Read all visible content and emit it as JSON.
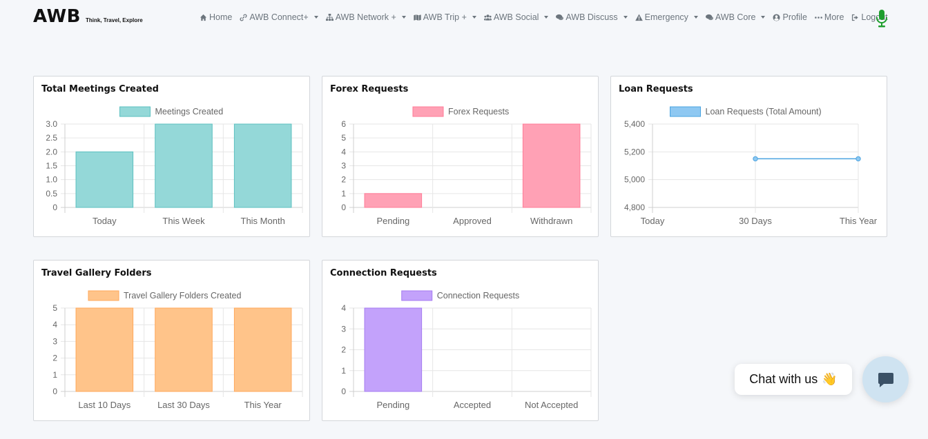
{
  "brand": {
    "name": "AWB",
    "tagline": "Think, Travel, Explore"
  },
  "nav": [
    {
      "label": "Home",
      "icon": "home-icon",
      "caret": false
    },
    {
      "label": "AWB Connect+",
      "icon": "link-icon",
      "caret": true
    },
    {
      "label": "AWB Network +",
      "icon": "sitemap-icon",
      "caret": true
    },
    {
      "label": "AWB Trip +",
      "icon": "map-icon",
      "caret": true
    },
    {
      "label": "AWB Social",
      "icon": "users-icon",
      "caret": true
    },
    {
      "label": "AWB Discuss",
      "icon": "comments-icon",
      "caret": true
    },
    {
      "label": "Emergency",
      "icon": "warning-icon",
      "caret": true
    },
    {
      "label": "AWB Core",
      "icon": "comments-icon",
      "caret": true
    },
    {
      "label": "Profile",
      "icon": "user-circle-icon",
      "caret": false
    },
    {
      "label": "More",
      "icon": "ellipsis-icon",
      "caret": false
    },
    {
      "label": "Logout",
      "icon": "logout-icon",
      "caret": false
    }
  ],
  "mic": {
    "icon": "microphone-icon",
    "color": "#1e9e2e"
  },
  "cards": [
    {
      "title": "Total Meetings Created",
      "chart_data": {
        "type": "bar",
        "categories": [
          "Today",
          "This Week",
          "This Month"
        ],
        "series": [
          {
            "name": "Meetings Created",
            "values": [
              2,
              3,
              3
            ]
          }
        ],
        "ylim": [
          0,
          3
        ],
        "yticks": [
          "3.0",
          "2.5",
          "2.0",
          "1.5",
          "1.0",
          "0.5",
          "0"
        ],
        "fill": "#94d8d8",
        "stroke": "#5bc0c0"
      }
    },
    {
      "title": "Forex Requests",
      "chart_data": {
        "type": "bar",
        "categories": [
          "Pending",
          "Approved",
          "Withdrawn"
        ],
        "series": [
          {
            "name": "Forex Requests",
            "values": [
              1,
              0,
              6
            ]
          }
        ],
        "ylim": [
          0,
          6
        ],
        "yticks": [
          "6",
          "5",
          "4",
          "3",
          "2",
          "1",
          "0"
        ],
        "fill": "#ffa1b5",
        "stroke": "#ff7b97"
      }
    },
    {
      "title": "Loan Requests",
      "chart_data": {
        "type": "line",
        "categories": [
          "Today",
          "30 Days",
          "This Year"
        ],
        "series": [
          {
            "name": "Loan Requests (Total Amount)",
            "values": [
              null,
              5150,
              5150
            ]
          }
        ],
        "ylim": [
          4800,
          5400
        ],
        "yticks": [
          "5,400",
          "5,200",
          "5,000",
          "4,800"
        ],
        "fill": "#8ec8f2",
        "stroke": "#4aa3e0"
      }
    },
    {
      "title": "Travel Gallery Folders",
      "chart_data": {
        "type": "bar",
        "categories": [
          "Last 10 Days",
          "Last 30 Days",
          "This Year"
        ],
        "series": [
          {
            "name": "Travel Gallery Folders Created",
            "values": [
              5,
              5,
              5
            ]
          }
        ],
        "ylim": [
          0,
          5
        ],
        "yticks": [
          "5",
          "4",
          "3",
          "2",
          "1",
          "0"
        ],
        "fill": "#ffc48a",
        "stroke": "#ffa75a"
      }
    },
    {
      "title": "Connection Requests",
      "chart_data": {
        "type": "bar",
        "categories": [
          "Pending",
          "Accepted",
          "Not Accepted"
        ],
        "series": [
          {
            "name": "Connection Requests",
            "values": [
              4,
              0,
              0
            ]
          }
        ],
        "ylim": [
          0,
          4
        ],
        "yticks": [
          "4",
          "3",
          "2",
          "1",
          "0"
        ],
        "fill": "#c3a2fb",
        "stroke": "#a47bf0"
      }
    }
  ],
  "chat": {
    "label": "Chat with us",
    "emoji": "👋",
    "icon": "chat-icon"
  }
}
